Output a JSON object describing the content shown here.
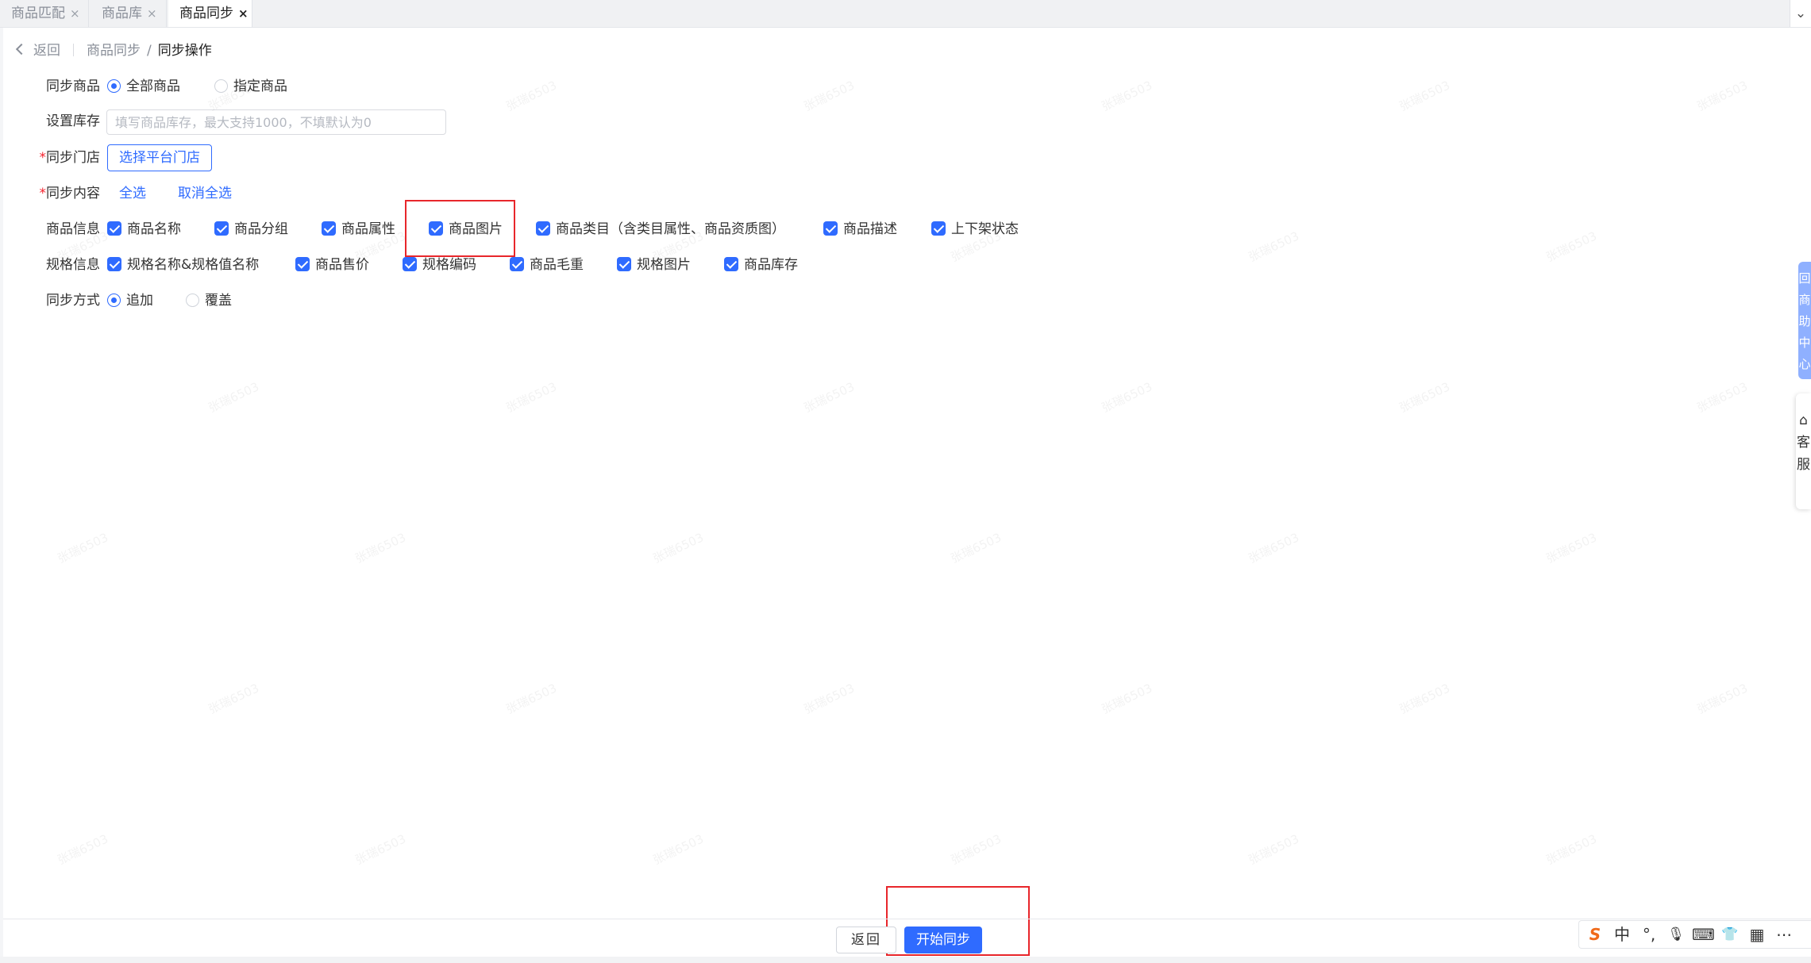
{
  "tabs": [
    {
      "label": "商品匹配",
      "close": "×"
    },
    {
      "label": "商品库",
      "close": "×"
    },
    {
      "label": "商品同步",
      "close": "×"
    }
  ],
  "tab_collapse": "⌄",
  "breadcrumb": {
    "back": "返回",
    "parent": "商品同步",
    "separator": "/",
    "current": "同步操作"
  },
  "form": {
    "sync_goods": {
      "label": "同步商品",
      "options": [
        "全部商品",
        "指定商品"
      ]
    },
    "stock": {
      "label": "设置库存",
      "placeholder": "填写商品库存，最大支持1000，不填默认为0"
    },
    "store": {
      "required": "*",
      "label": "同步门店",
      "button": "选择平台门店"
    },
    "content": {
      "required": "*",
      "label": "同步内容",
      "select_all": "全选",
      "deselect_all": "取消全选"
    },
    "goods_info": {
      "label": "商品信息",
      "items": [
        "商品名称",
        "商品分组",
        "商品属性",
        "商品图片",
        "商品类目（含类目属性、商品资质图）",
        "商品描述",
        "上下架状态"
      ]
    },
    "spec_info": {
      "label": "规格信息",
      "items": [
        "规格名称&规格值名称",
        "商品售价",
        "规格编码",
        "商品毛重",
        "规格图片",
        "商品库存"
      ]
    },
    "sync_mode": {
      "label": "同步方式",
      "options": [
        "追加",
        "覆盖"
      ]
    }
  },
  "footer": {
    "back": "返回",
    "start": "开始同步"
  },
  "float_blue_text": "回商助中心",
  "float_white_text": "⌂客服",
  "ime": {
    "logo": "S",
    "mode": "中",
    "punct": "°,",
    "mic": "🎙",
    "keyboard": "⌨",
    "skin": "👕",
    "grid": "▦",
    "more": "⋯"
  },
  "watermark": "张瑞6503",
  "colors": {
    "primary": "#2f6bff",
    "highlight": "#e8262b",
    "required": "#f5222d"
  }
}
